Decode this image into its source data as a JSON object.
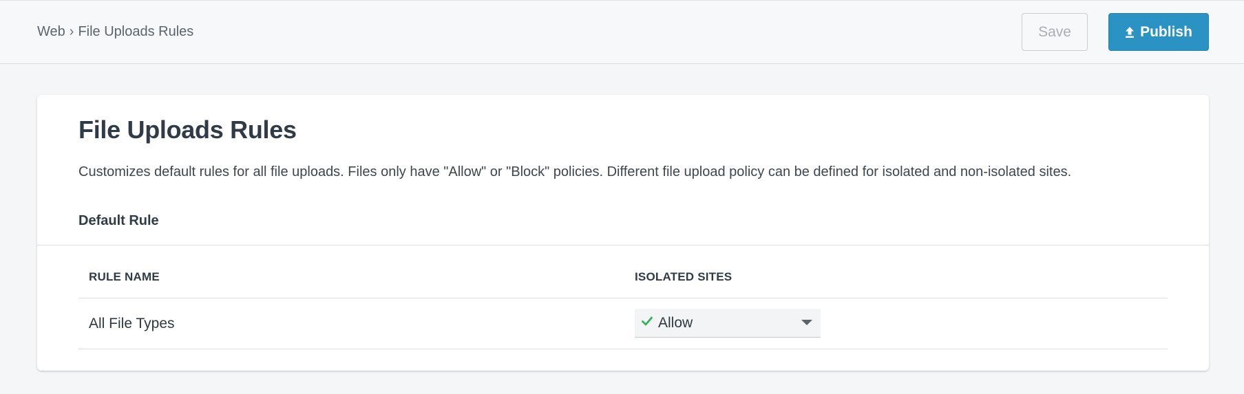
{
  "breadcrumb": {
    "parent": "Web",
    "separator": "›",
    "current": "File Uploads Rules"
  },
  "toolbar": {
    "save_label": "Save",
    "publish_label": "Publish",
    "publish_icon": "upload-icon"
  },
  "card": {
    "title": "File Uploads Rules",
    "description": "Customizes default rules for all file uploads. Files only have \"Allow\" or \"Block\" policies. Different file upload policy can be defined for isolated and non-isolated sites.",
    "section_title": "Default Rule"
  },
  "table": {
    "columns": [
      "RULE NAME",
      "ISOLATED SITES"
    ],
    "rows": [
      {
        "rule_name": "All File Types",
        "isolated_sites": {
          "value": "Allow",
          "icon": "check-icon",
          "icon_color": "#2fb45a"
        }
      }
    ]
  },
  "colors": {
    "accent": "#2b93c4",
    "allow": "#2fb45a"
  }
}
